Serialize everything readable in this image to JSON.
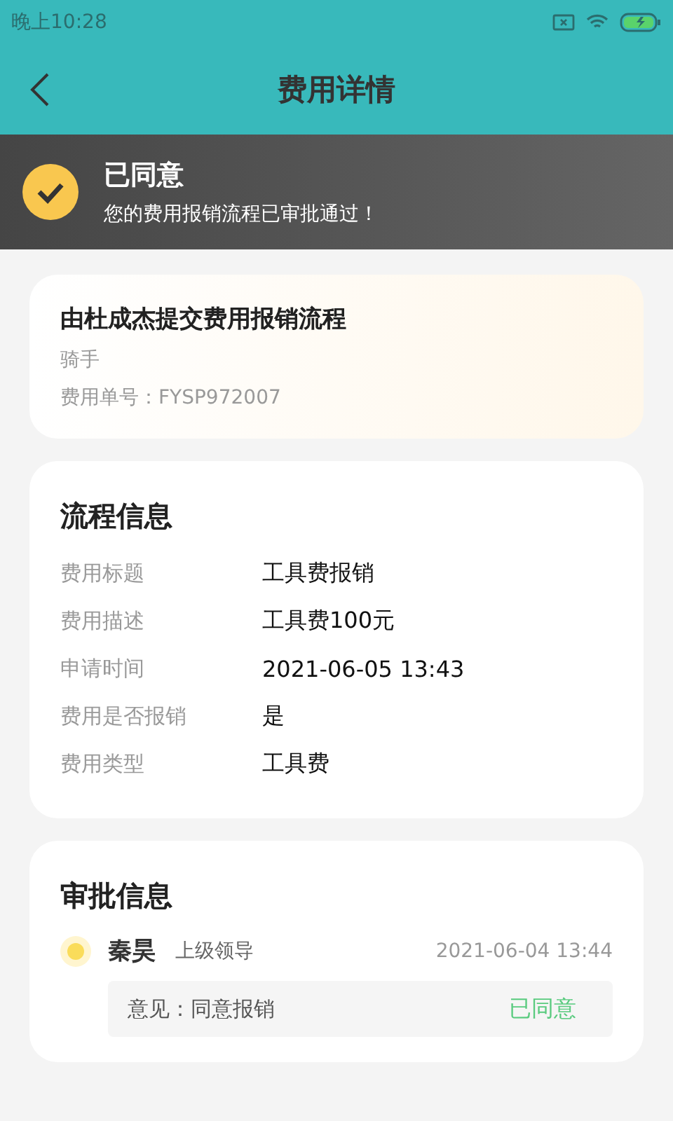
{
  "status_bar": {
    "time": "晚上10:28"
  },
  "header": {
    "title": "费用详情"
  },
  "banner": {
    "title": "已同意",
    "message": "您的费用报销流程已审批通过！"
  },
  "summary": {
    "title": "由杜成杰提交费用报销流程",
    "role": "骑手",
    "number": "费用单号：FYSP972007"
  },
  "process": {
    "title": "流程信息",
    "fields": [
      {
        "label": "费用标题",
        "value": "工具费报销"
      },
      {
        "label": "费用描述",
        "value": "工具费100元"
      },
      {
        "label": "申请时间",
        "value": "2021-06-05 13:43"
      },
      {
        "label": "费用是否报销",
        "value": "是"
      },
      {
        "label": "费用类型",
        "value": "工具费"
      }
    ]
  },
  "approval": {
    "title": "审批信息",
    "items": [
      {
        "name": "秦昊",
        "role": "上级领导",
        "time": "2021-06-04 13:44",
        "opinion": "意见：同意报销",
        "status": "已同意"
      }
    ]
  }
}
